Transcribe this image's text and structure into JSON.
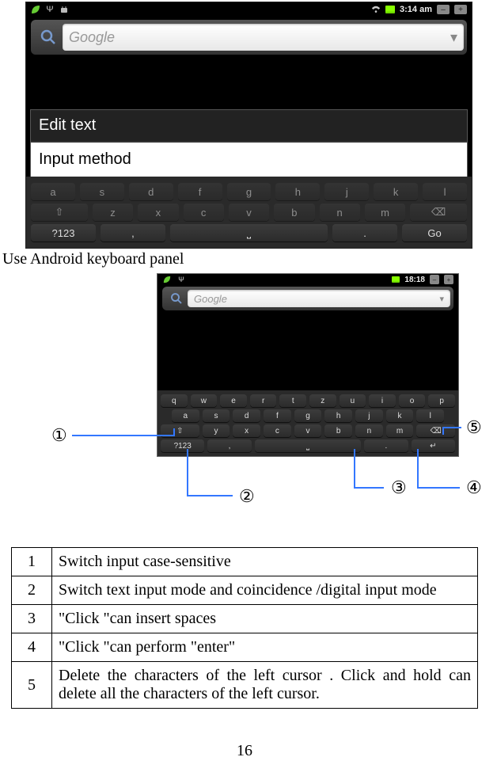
{
  "screenshot1": {
    "statusbar": {
      "time": "3:14 am"
    },
    "search_placeholder": "Google",
    "dialog": {
      "title": "Edit text",
      "item": "Input method"
    },
    "keys_row1": [
      "a",
      "s",
      "d",
      "f",
      "g",
      "h",
      "j",
      "k",
      "l"
    ],
    "keys_row2_shift": "⇧",
    "keys_row2": [
      "z",
      "x",
      "c",
      "v",
      "b",
      "n",
      "m"
    ],
    "keys_row2_del": "⌫",
    "keys_row3": {
      "sym": "?123",
      "comma": ",",
      "space": "⎵",
      "period": ".",
      "go": "Go"
    }
  },
  "caption": "Use Android keyboard panel",
  "screenshot2": {
    "statusbar": {
      "time": "18:18"
    },
    "search_placeholder": "Google",
    "keys_r1": [
      "q",
      "w",
      "e",
      "r",
      "t",
      "z",
      "u",
      "i",
      "o",
      "p"
    ],
    "keys_r2": [
      "a",
      "s",
      "d",
      "f",
      "g",
      "h",
      "j",
      "k",
      "l"
    ],
    "keys_r3_shift": "⇧",
    "keys_r3": [
      "y",
      "x",
      "c",
      "v",
      "b",
      "n",
      "m"
    ],
    "keys_r3_del": "⌫",
    "keys_r4": {
      "sym": "?123",
      "comma": ",",
      "space": "⎵",
      "period": ".",
      "ret": "↵"
    }
  },
  "callouts": {
    "c1": "①",
    "c2": "②",
    "c3": "③",
    "c4": "④",
    "c5": "⑤"
  },
  "table": {
    "r1n": "1",
    "r1": "Switch input case-sensitive",
    "r2n": "2",
    "r2": "Switch text input mode and coincidence /digital input mode",
    "r3n": "3",
    "r3": "\"Click \"can insert spaces",
    "r4n": "4",
    "r4": "\"Click \"can perform \"enter\"",
    "r5n": "5",
    "r5": "Delete the characters of the left cursor . Click and hold   can delete all the characters of the left cursor."
  },
  "page_number": "16"
}
